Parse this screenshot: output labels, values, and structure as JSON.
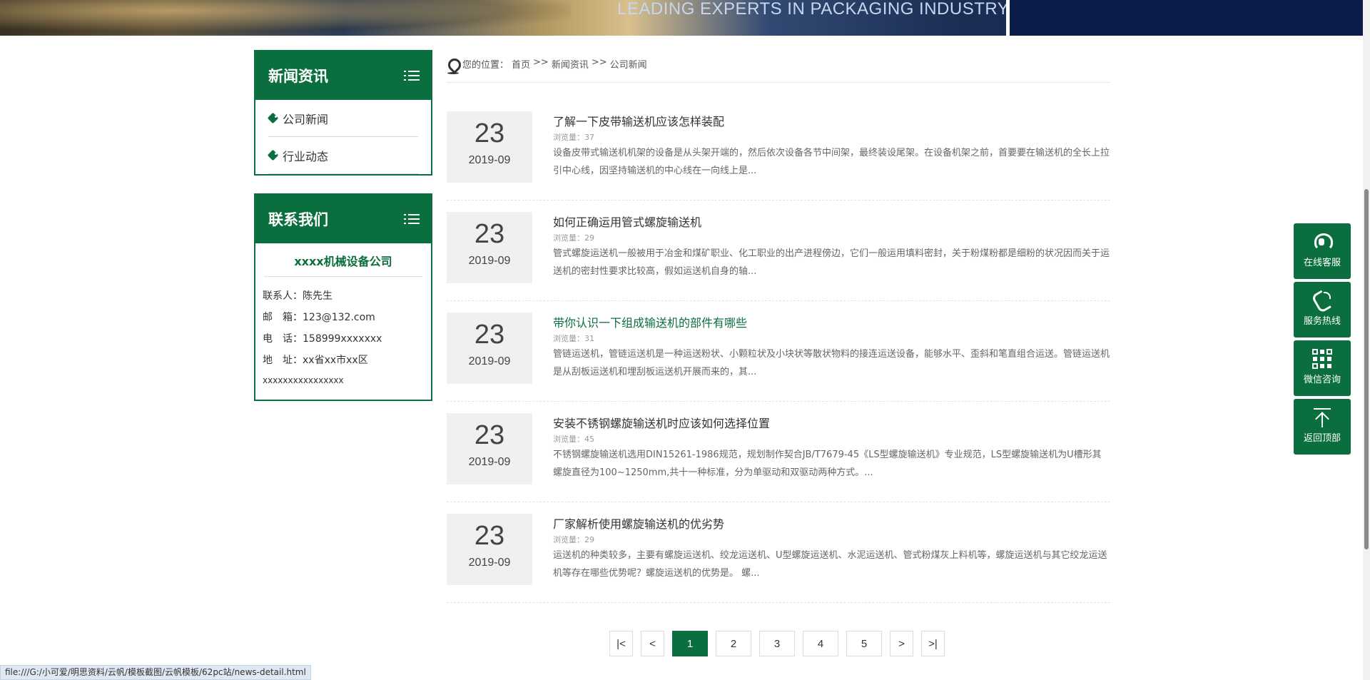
{
  "banner": {
    "slogan": "LEADING EXPERTS IN PACKAGING INDUSTRY"
  },
  "sidebar": {
    "news": {
      "title": "新闻资讯",
      "items": [
        {
          "label": "公司新闻"
        },
        {
          "label": "行业动态"
        }
      ]
    },
    "contact": {
      "title": "联系我们",
      "company": "xxxx机械设备公司",
      "person": "联系人：陈先生",
      "email": "邮　箱：123@132.com",
      "phone": "电　话：158999xxxxxxx",
      "address": "地　址：xx省xx市xx区",
      "address_cont": "xxxxxxxxxxxxxxxx"
    }
  },
  "breadcrumb": {
    "prefix": "您的位置：",
    "home": "首页",
    "sep1": ">>",
    "level1": "新闻资讯",
    "sep2": ">>",
    "level2": "公司新闻"
  },
  "news": [
    {
      "day": "23",
      "ym": "2019-09",
      "title": "了解一下皮带输送机应该怎样装配",
      "views": "浏览量：37",
      "summary": "设备皮带式输送机机架的设备是从头架开端的，然后依次设备各节中间架，最终装设尾架。在设备机架之前，首要要在输送机的全长上拉引中心线，因坚持输送机的中心线在一向线上是..."
    },
    {
      "day": "23",
      "ym": "2019-09",
      "title": "如何正确运用管式螺旋输送机",
      "views": "浏览量：29",
      "summary": "管式螺旋运送机一般被用于冶金和煤矿职业、化工职业的出产进程傍边，它们一般运用填料密封，关于粉煤粉都是细粉的状况因而关于运送机的密封性要求比较高，假如运送机自身的轴..."
    },
    {
      "day": "23",
      "ym": "2019-09",
      "title": "带你认识一下组成输送机的部件有哪些",
      "views": "浏览量：31",
      "summary": "管链运送机，管链运送机是一种运送粉状、小颗粒状及小块状等散状物料的接连运送设备，能够水平、歪斜和笔直组合运送。管链运送机是从刮板运送机和埋刮板运送机开展而来的，其..."
    },
    {
      "day": "23",
      "ym": "2019-09",
      "title": "安装不锈钢螺旋输送机时应该如何选择位置",
      "views": "浏览量：45",
      "summary": "不锈钢螺旋输送机选用DIN15261-1986规范，规划制作契合JB/T7679-45《LS型螺旋输送机》专业规范，LS型螺旋输送机为U槽形其螺旋直径为100~1250mm,共十一种标准，分为单驱动和双驱动两种方式。..."
    },
    {
      "day": "23",
      "ym": "2019-09",
      "title": "厂家解析使用螺旋输送机的优劣势",
      "views": "浏览量：29",
      "summary": "运送机的种类较多，主要有螺旋运送机、绞龙运送机、U型螺旋运送机、水泥运送机、管式粉煤灰上料机等，螺旋运送机与其它绞龙运送机等存在哪些优势呢？螺旋运送机的优势是。 螺..."
    }
  ],
  "pager": {
    "first": "|<",
    "prev": "<",
    "pages": [
      "1",
      "2",
      "3",
      "4",
      "5"
    ],
    "current": "1",
    "next": ">",
    "last": ">|"
  },
  "float_panel": {
    "service": "在线客服",
    "hotline": "服务热线",
    "wechat": "微信咨询",
    "top": "返回顶部"
  },
  "statusbar": {
    "url": "file:///G:/小可爱/明思资料/云帆/模板截图/云帆模板/62pc站/news-detail.html"
  },
  "colors": {
    "brand_green": "#0b6e3e",
    "banner_navy": "#0c1c48"
  }
}
